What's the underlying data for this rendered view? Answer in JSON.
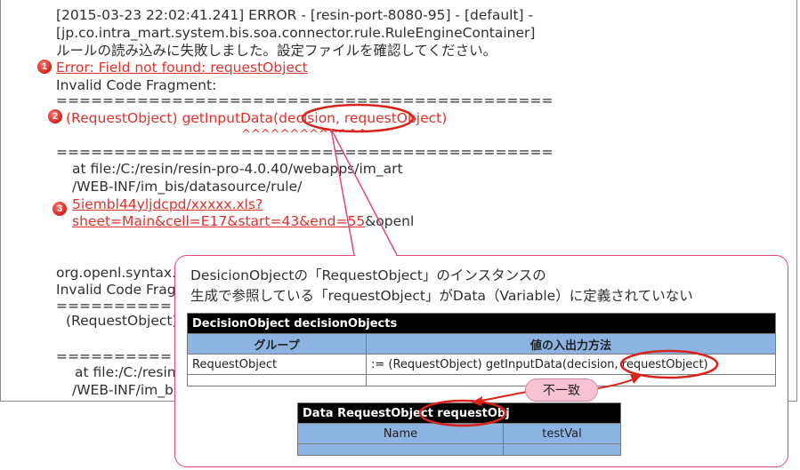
{
  "log": {
    "line1": "[2015-03-23 22:02:41.241] ERROR - [resin-port-8080-95] - [default] -",
    "line2": "[jp.co.intra_mart.system.bis.soa.connector.rule.RuleEngineContainer]",
    "line3": "ルールの読み込みに失敗しました。設定ファイルを確認してください。",
    "error_line": "Error: Field not found: requestObject",
    "invalid_fragment": "Invalid Code Fragment:",
    "separator": "===========================================",
    "code_line": "(RequestObject) getInputData(decision, requestObject)",
    "carets": "^^^^^^^^^^^^^",
    "separator2": "===========================================",
    "at_file": "at file:/C:/resin/resin-pro-4.0.40/webapps/im_art",
    "webinf": "/WEB-INF/im_bis/datasource/rule/",
    "xls": "5iembl44yljdcpd/xxxxx.xls?",
    "sheet": "sheet=Main&cell=E17&start=43&end=55",
    "openl_suffix": "&openl",
    "org_line": "org.openl.syntax.S",
    "invalid_fragment2": "Invalid Code Fragm",
    "separator3": "==========",
    "code_line2": "(RequestObject) g",
    "separator4": "==========",
    "at_file2": "at file:/C:/resin/",
    "webinf2": "/WEB-INF/im_bi"
  },
  "markers": [
    "1",
    "2",
    "3"
  ],
  "callout": {
    "line1": "DesicionObjectの「RequestObject」のインスタンスの",
    "line2": "生成で参照している「requestObject」がData（Variable）に定義されていない"
  },
  "table1": {
    "title": "DecisionObject decisionObjects",
    "col1": "グループ",
    "col2": "値の入出力方法",
    "row_group": "RequestObject",
    "row_value": ":=  (RequestObject) getInputData(decision, requestObject)"
  },
  "table2": {
    "title": "Data RequestObject requestObj",
    "col1": "Name",
    "col2": "testVal"
  },
  "mismatch_label": "不一致",
  "colors": {
    "error_red": "#e0312b",
    "callout_border": "#e0457b",
    "header_blue": "#8db3e2"
  }
}
